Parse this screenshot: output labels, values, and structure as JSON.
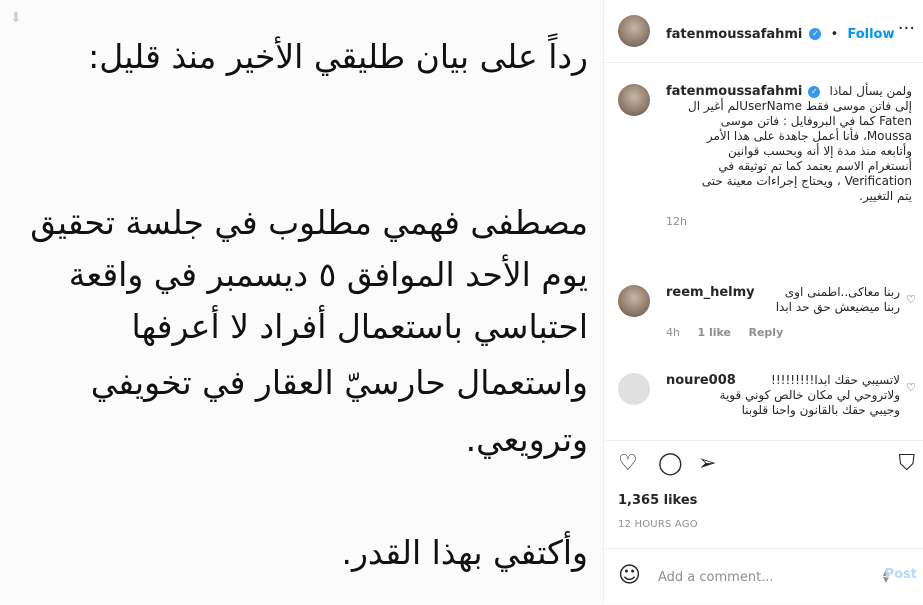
{
  "media": {
    "lines": [
      "رداً على بيان طليقي الأخير منذ قليل:",
      "مصطفى فهمي مطلوب في جلسة تحقيق",
      "يوم الأحد الموافق ٥ ديسمبر في واقعة",
      "احتباسي باستعمال أفراد لا أعرفها",
      "واستعمال حارسيّ العقار في تخويفي",
      "وترويعي.",
      "وأكتفي بهذا القدر."
    ]
  },
  "header": {
    "username": "fatenmoussafahmi",
    "dot": "•",
    "follow_label": "Follow"
  },
  "caption": {
    "username": "fatenmoussafahmi",
    "lines": [
      "ولمن يسأل لماذا",
      "إلى فاتن موسى فقط UserNameلم أغير ال",
      "Faten كما في البروفايل : فاتن موسى",
      "Moussa، فأنا أعمل جاهدة على هذا الأمر",
      "وأتابعه منذ مدة إلا أنه وبحسب قوانين",
      "أنستغرام الاسم يعتمد كما تم توثيقه في",
      "Verification ، ويحتاج إجراءات معينة حتى",
      "يتم التغيير."
    ],
    "time": "12h"
  },
  "comments": [
    {
      "username": "reem_helmy",
      "lines": [
        "ربنا معاكى..اطمنى اوى",
        "ربنا ميضيعش حق حد ابدا"
      ],
      "time": "4h",
      "likes": "1 like",
      "reply": "Reply"
    },
    {
      "username": "noure008",
      "lines": [
        "لاتسيبي حقك ابدا!!!!!!!!!",
        "ولاتروحي لي مكان خالص كوني قوية",
        "وجيبي حقك بالقانون واحنا قلوبنا"
      ]
    }
  ],
  "actions": {
    "likes": "1,365 likes",
    "time": "12 HOURS AGO"
  },
  "add_comment": {
    "placeholder": "Add a comment...",
    "post_label": "Post"
  }
}
